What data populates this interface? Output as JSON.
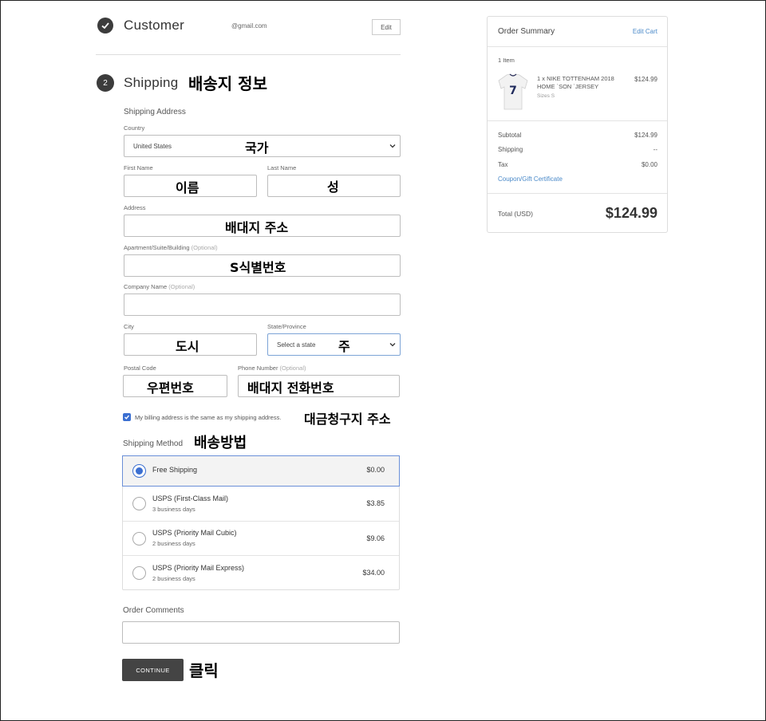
{
  "customer": {
    "title": "Customer",
    "email": "@gmail.com",
    "edit_label": "Edit"
  },
  "shipping": {
    "step_number": "2",
    "title": "Shipping",
    "title_note": "배송지 정보",
    "address_heading": "Shipping Address",
    "country": {
      "label": "Country",
      "value": "United States",
      "note": "국가"
    },
    "first_name": {
      "label": "First Name",
      "note": "이름"
    },
    "last_name": {
      "label": "Last Name",
      "note": "성"
    },
    "address": {
      "label": "Address",
      "note": "배대지 주소"
    },
    "apartment": {
      "label": "Apartment/Suite/Building",
      "optional": "(Optional)",
      "note": "S식별번호"
    },
    "company": {
      "label": "Company Name",
      "optional": "(Optional)"
    },
    "city": {
      "label": "City",
      "note": "도시"
    },
    "state": {
      "label": "State/Province",
      "value": "Select a state",
      "note": "주"
    },
    "postal": {
      "label": "Postal Code",
      "note": "우편번호"
    },
    "phone": {
      "label": "Phone Number",
      "optional": "(Optional)",
      "note": "배대지 전화번호"
    },
    "billing_same": {
      "label": "My billing address is the same as my shipping address.",
      "checked": true,
      "note": "대금청구지 주소"
    },
    "method_heading": "Shipping Method",
    "method_note": "배송방법",
    "methods": [
      {
        "name": "Free Shipping",
        "sub": "",
        "price": "$0.00",
        "selected": true
      },
      {
        "name": "USPS (First-Class Mail)",
        "sub": "3 business days",
        "price": "$3.85",
        "selected": false
      },
      {
        "name": "USPS (Priority Mail Cubic)",
        "sub": "2 business days",
        "price": "$9.06",
        "selected": false
      },
      {
        "name": "USPS (Priority Mail Express)",
        "sub": "2 business days",
        "price": "$34.00",
        "selected": false
      }
    ],
    "comments_label": "Order Comments",
    "continue_label": "CONTINUE",
    "continue_note": "클릭"
  },
  "summary": {
    "title": "Order Summary",
    "edit_cart": "Edit Cart",
    "item_count": "1 Item",
    "item": {
      "name_line1": "1 x NIKE TOTTENHAM 2018",
      "name_line2": "HOME `SON `JERSEY",
      "size": "Sizes S",
      "price": "$124.99",
      "jersey_number": "7"
    },
    "subtotal_label": "Subtotal",
    "subtotal": "$124.99",
    "shipping_label": "Shipping",
    "shipping": "--",
    "tax_label": "Tax",
    "tax": "$0.00",
    "coupon": "Coupon/Gift Certificate",
    "total_label": "Total (USD)",
    "total": "$124.99"
  },
  "colors": {
    "accent": "#3b6fd1",
    "link": "#4b8ac9",
    "button": "#444444"
  }
}
